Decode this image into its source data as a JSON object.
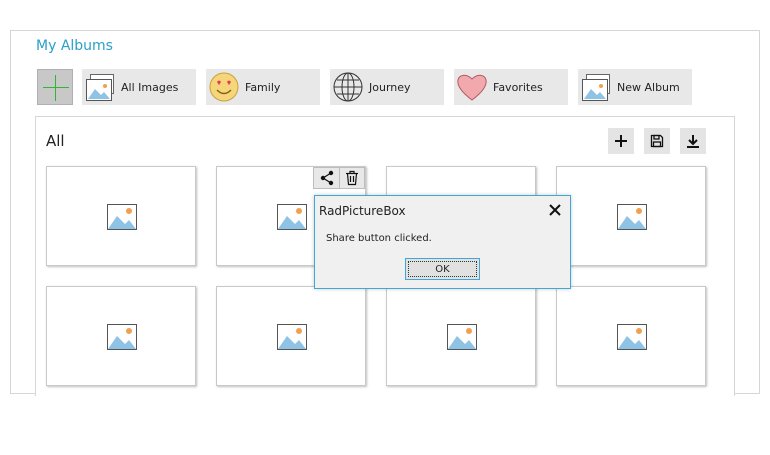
{
  "header": {
    "title": "My Albums"
  },
  "albums": [
    {
      "label": "All Images",
      "icon": "image-stack-icon"
    },
    {
      "label": "Family",
      "icon": "smiley-icon"
    },
    {
      "label": "Journey",
      "icon": "globe-icon"
    },
    {
      "label": "Favorites",
      "icon": "heart-icon"
    },
    {
      "label": "New Album",
      "icon": "image-stack-icon"
    }
  ],
  "gallery": {
    "title": "All",
    "toolbar": [
      "add-icon",
      "save-icon",
      "download-icon"
    ],
    "card_count": 8
  },
  "dialog": {
    "title": "RadPictureBox",
    "message": "Share button clicked.",
    "ok_label": "OK"
  },
  "colors": {
    "accent": "#2a9fc9",
    "add": "#2eb82e",
    "dialog_border": "#3fa9d6"
  }
}
